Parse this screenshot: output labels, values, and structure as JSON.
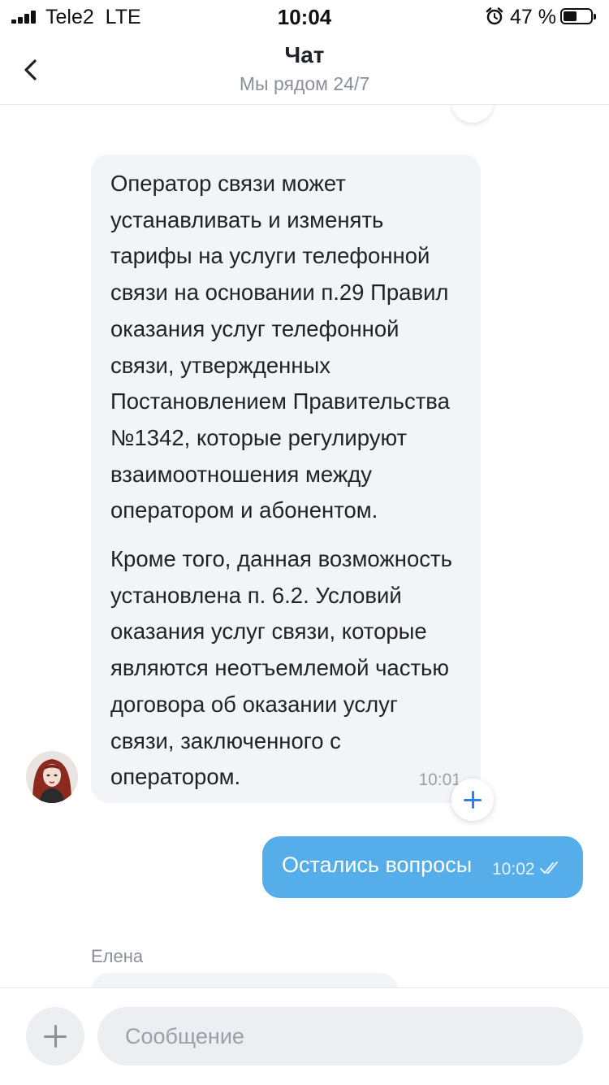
{
  "status_bar": {
    "carrier": "Tele2",
    "network": "LTE",
    "time": "10:04",
    "battery_percent": "47 %",
    "battery_level": 0.47,
    "icons": [
      "signal-icon",
      "alarm-icon",
      "battery-icon"
    ]
  },
  "header": {
    "title": "Чат",
    "subtitle": "Мы рядом 24/7",
    "back_icon": "chevron-left-icon"
  },
  "messages": [
    {
      "direction": "incoming",
      "paragraphs": [
        "Оператор связи может устанавливать и изменять тарифы на услуги телефонной связи на основании п.29 Правил оказания услуг телефонной связи, утвержденных Постановлением Правительства №1342, которые регулируют взаимоотношения между оператором и абонентом.",
        "Кроме того, данная возможность установлена п. 6.2. Условий оказания услуг связи, которые являются неотъемлемой частью договора об оказании услуг связи, заключенного с оператором."
      ],
      "time": "10:01",
      "reaction_icon": "plus-icon"
    },
    {
      "direction": "outgoing",
      "text": "Остались вопросы",
      "time": "10:02",
      "status_icon": "read-check-icon"
    }
  ],
  "next_sender": "Елена",
  "composer": {
    "placeholder": "Сообщение",
    "attach_icon": "plus-icon"
  },
  "colors": {
    "outgoing_bubble": "#55aee9",
    "incoming_bubble": "#f3f4f7",
    "accent": "#2f80ed"
  }
}
